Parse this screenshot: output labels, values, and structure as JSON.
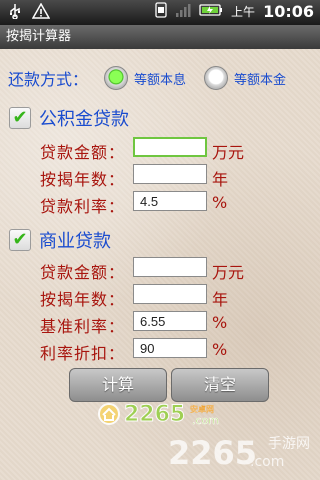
{
  "status_bar": {
    "time": "10:06",
    "period": "上午"
  },
  "app": {
    "title": "按揭计算器"
  },
  "repayment": {
    "label": "还款方式：",
    "options": [
      {
        "label": "等额本息",
        "selected": true
      },
      {
        "label": "等额本金",
        "selected": false
      }
    ]
  },
  "provident_fund": {
    "title": "公积金贷款",
    "checked": true,
    "amount_label": "贷款金额：",
    "amount_value": "",
    "amount_unit": "万元",
    "years_label": "按揭年数：",
    "years_value": "",
    "years_unit": "年",
    "rate_label": "贷款利率：",
    "rate_value": "4.5",
    "rate_unit": "%"
  },
  "commercial": {
    "title": "商业贷款",
    "checked": true,
    "amount_label": "贷款金额：",
    "amount_value": "",
    "amount_unit": "万元",
    "years_label": "按揭年数：",
    "years_value": "",
    "years_unit": "年",
    "base_rate_label": "基准利率：",
    "base_rate_value": "6.55",
    "base_rate_unit": "%",
    "discount_label": "利率折扣：",
    "discount_value": "90",
    "discount_unit": "%"
  },
  "buttons": {
    "calculate": "计算",
    "clear": "清空"
  },
  "watermark": {
    "brand_top": "2265",
    "brand_top_suffix": "安卓网",
    "brand_top_domain": ".com",
    "brand_bottom": "2265",
    "brand_bottom_domain": ".com",
    "brand_bottom_suffix": "手游网"
  }
}
